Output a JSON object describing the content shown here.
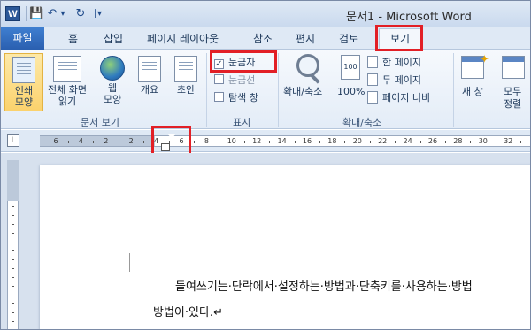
{
  "app": {
    "logo": "W",
    "title": "문서1 - Microsoft Word",
    "qat": [
      "save-icon",
      "undo-icon",
      "redo-icon",
      "customize-qat-icon"
    ],
    "qat_glyphs": {
      "save": "💾",
      "undo": "↶",
      "undo_dropdown": "▾",
      "redo": "↻",
      "customize": "∣▾"
    }
  },
  "tabs": {
    "file": "파일",
    "items": [
      "홈",
      "삽입",
      "페이지 레이아웃",
      "참조",
      "편지",
      "검토"
    ],
    "active": "보기"
  },
  "ribbon": {
    "doc_views": {
      "label": "문서 보기",
      "buttons": [
        {
          "line1": "인쇄",
          "line2": "모양",
          "selected": true
        },
        {
          "line1": "전체 화면",
          "line2": "읽기"
        },
        {
          "line1": "웹",
          "line2": "모양"
        },
        {
          "line1": "개요",
          "line2": ""
        },
        {
          "line1": "초안",
          "line2": ""
        }
      ]
    },
    "show": {
      "label": "표시",
      "checkboxes": [
        {
          "label": "눈금자",
          "checked": true
        },
        {
          "label": "눈금선",
          "checked": false
        },
        {
          "label": "탐색 창",
          "checked": false
        }
      ],
      "check_glyph": "✓"
    },
    "zoom": {
      "label": "확대/축소",
      "zoom_button": "확대/축소",
      "percent_button": "100%",
      "percent_icon_text": "100",
      "small_buttons": [
        "한 페이지",
        "두 페이지",
        "페이지 너비"
      ]
    },
    "window": {
      "new_window": "새 창",
      "arrange_line1": "모두",
      "arrange_line2": "정렬",
      "star_glyph": "✦"
    }
  },
  "ruler": {
    "corner": "L",
    "numbers": [
      "6",
      "4",
      "2",
      "2",
      "4",
      "6",
      "8",
      "10",
      "12",
      "14",
      "16",
      "18",
      "20",
      "22",
      "24",
      "26",
      "28",
      "30",
      "32"
    ]
  },
  "document": {
    "line1": "들여쓰기는·단락에서·설정하는·방법과·단축키를·사용하는·방법",
    "line2": "방법이·있다.↵"
  },
  "highlight_color": "#e21f26"
}
